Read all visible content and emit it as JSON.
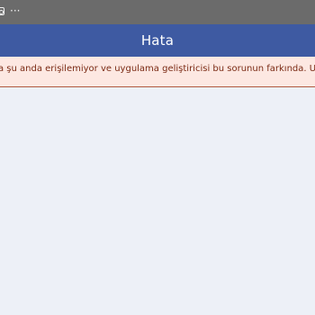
{
  "status_bar": {
    "overflow_label": "···"
  },
  "app_bar": {
    "title": "Hata"
  },
  "error_banner": {
    "message": "a şu anda erişilemiyor ve uygulama geliştiricisi bu sorunun farkında. Uygulama"
  },
  "colors": {
    "status_bar": "#6b6b6b",
    "app_bar": "#3e5aa2",
    "banner_background": "#fde8e2",
    "banner_text": "#7a2a14",
    "page_background": "#edf0f7"
  }
}
